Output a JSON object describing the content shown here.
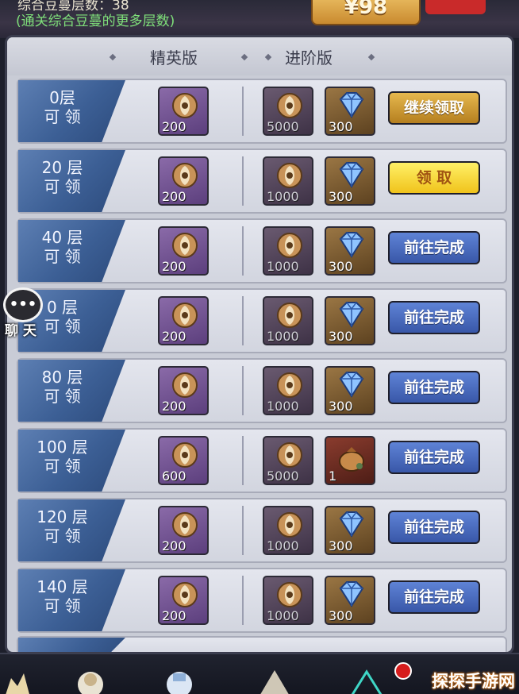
{
  "top": {
    "summary_text": "综合豆蔓层数：38",
    "link_text": "(通关综合豆蔓的更多层数)",
    "price": "¥98"
  },
  "headers": {
    "elite": "精英版",
    "advanced": "进阶版"
  },
  "rows": [
    {
      "level": "0层",
      "can": "可 领",
      "elite_qty": "200",
      "adv_bean_qty": "5000",
      "adv_second_qty": "300",
      "adv_second_icon": "diamond-icon",
      "button": "继续领取",
      "button_style": "continue"
    },
    {
      "level": "20 层",
      "can": "可 领",
      "elite_qty": "200",
      "adv_bean_qty": "1000",
      "adv_second_qty": "300",
      "adv_second_icon": "diamond-icon",
      "button": "领 取",
      "button_style": "claim"
    },
    {
      "level": "40 层",
      "can": "可 领",
      "elite_qty": "200",
      "adv_bean_qty": "1000",
      "adv_second_qty": "300",
      "adv_second_icon": "diamond-icon",
      "button": "前往完成",
      "button_style": "go"
    },
    {
      "level": "0 层",
      "can": "可 领",
      "elite_qty": "200",
      "adv_bean_qty": "1000",
      "adv_second_qty": "300",
      "adv_second_icon": "diamond-icon",
      "button": "前往完成",
      "button_style": "go"
    },
    {
      "level": "80 层",
      "can": "可 领",
      "elite_qty": "200",
      "adv_bean_qty": "1000",
      "adv_second_qty": "300",
      "adv_second_icon": "diamond-icon",
      "button": "前往完成",
      "button_style": "go"
    },
    {
      "level": "100 层",
      "can": "可 领",
      "elite_qty": "600",
      "adv_bean_qty": "5000",
      "adv_second_qty": "1",
      "adv_second_icon": "bag-icon",
      "button": "前往完成",
      "button_style": "go"
    },
    {
      "level": "120 层",
      "can": "可 领",
      "elite_qty": "200",
      "adv_bean_qty": "1000",
      "adv_second_qty": "300",
      "adv_second_icon": "diamond-icon",
      "button": "前往完成",
      "button_style": "go"
    },
    {
      "level": "140 层",
      "can": "可 领",
      "elite_qty": "200",
      "adv_bean_qty": "1000",
      "adv_second_qty": "300",
      "adv_second_icon": "diamond-icon",
      "button": "前往完成",
      "button_style": "go"
    }
  ],
  "chat": {
    "label": "聊 天"
  },
  "watermark": "探探手游网",
  "colors": {
    "panel": "#c9ccd6",
    "level_tab": "#3c5f95",
    "button_go": "#3957a8",
    "button_claim": "#f0c31c",
    "button_continue": "#b57f1f",
    "elite_item": "#6d4f8f",
    "price_badge": "#e0aa4e"
  }
}
